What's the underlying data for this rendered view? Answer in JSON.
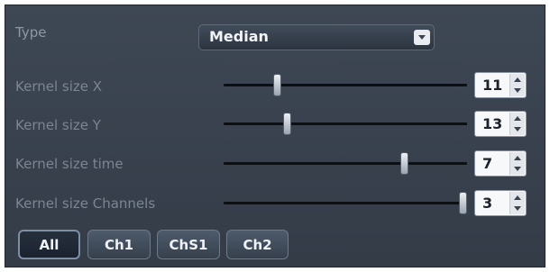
{
  "type": {
    "label": "Type",
    "value": "Median"
  },
  "sliders": [
    {
      "label": "Kernel size X",
      "value": "11",
      "level": 0.22
    },
    {
      "label": "Kernel size Y",
      "value": "13",
      "level": 0.26
    },
    {
      "label": "Kernel size time",
      "value": "7",
      "level": 0.74
    },
    {
      "label": "Kernel size Channels",
      "value": "3",
      "level": 0.98
    }
  ],
  "channel_buttons": [
    "All",
    "Ch1",
    "ChS1",
    "Ch2"
  ],
  "active_channel": "All"
}
